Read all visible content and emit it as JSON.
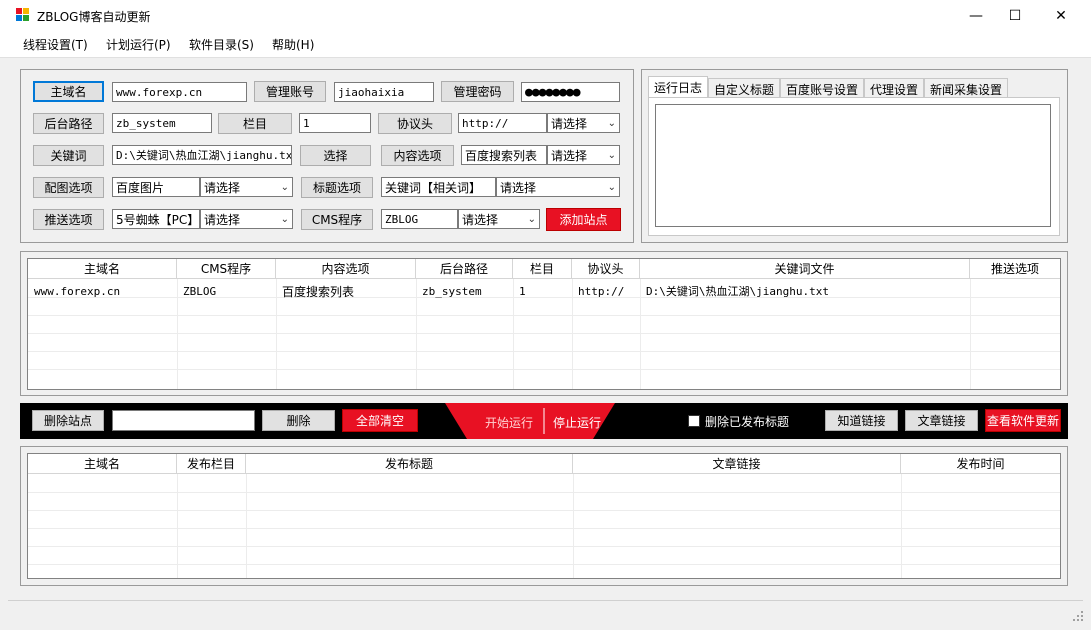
{
  "window": {
    "title": "ZBLOG博客自动更新",
    "minimize_glyph": "—",
    "maximize_glyph": "☐",
    "close_glyph": "✕"
  },
  "menu": [
    "线程设置(T)",
    "计划运行(P)",
    "软件目录(S)",
    "帮助(H)"
  ],
  "form": {
    "domain_label": "主域名",
    "domain_value": "www.forexp.cn",
    "account_label": "管理账号",
    "account_value": "jiaohaixia",
    "password_label": "管理密码",
    "password_value": "●●●●●●●●",
    "admin_path_label": "后台路径",
    "admin_path_value": "zb_system",
    "column_label": "栏目",
    "column_value": "1",
    "protocol_label": "协议头",
    "protocol_value": "http://",
    "protocol_select": "请选择",
    "keyword_label": "关键词",
    "keyword_value": "D:\\关键词\\热血江湖\\jianghu.txt",
    "choose_label": "选择",
    "content_label": "内容选项",
    "content_value": "百度搜索列表",
    "content_select": "请选择",
    "image_label": "配图选项",
    "image_value": "百度图片",
    "image_select": "请选择",
    "title_label": "标题选项",
    "title_value": "关键词【相关词】",
    "title_select": "请选择",
    "push_label": "推送选项",
    "push_value": "5号蜘蛛【PC】",
    "push_select": "请选择",
    "cms_label": "CMS程序",
    "cms_value": "ZBLOG",
    "cms_select": "请选择",
    "add_site_label": "添加站点"
  },
  "tabs": [
    "运行日志",
    "自定义标题",
    "百度账号设置",
    "代理设置",
    "新闻采集设置"
  ],
  "sites_table": {
    "headers": [
      "主域名",
      "CMS程序",
      "内容选项",
      "后台路径",
      "栏目",
      "协议头",
      "关键词文件",
      "推送选项"
    ],
    "row": [
      "www.forexp.cn",
      "ZBLOG",
      "百度搜索列表",
      "zb_system",
      "1",
      "http://",
      "D:\\关键词\\热血江湖\\jianghu.txt",
      ""
    ]
  },
  "controls": {
    "delete_site": "删除站点",
    "delete": "删除",
    "clear_all": "全部清空",
    "start": "开始运行",
    "stop": "停止运行",
    "delete_published": "删除已发布标题",
    "zhidao_link": "知道链接",
    "article_link": "文章链接",
    "check_update": "查看软件更新"
  },
  "publish_table": {
    "headers": [
      "主域名",
      "发布栏目",
      "发布标题",
      "文章链接",
      "发布时间"
    ]
  },
  "colors": {
    "accent_red": "#e81123",
    "selection_blue": "#0078d7"
  }
}
